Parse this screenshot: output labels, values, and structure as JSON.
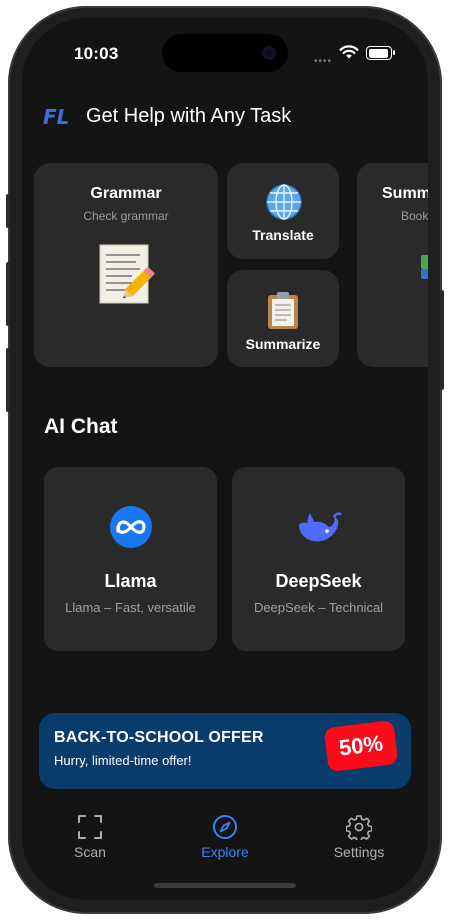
{
  "status": {
    "time": "10:03"
  },
  "header": {
    "title": "Get Help with Any Task",
    "logo_text": "FL"
  },
  "tools": {
    "grammar": {
      "title": "Grammar",
      "subtitle": "Check grammar",
      "icon": "memo-pencil-icon"
    },
    "translate": {
      "title": "Translate",
      "icon": "globe-icon"
    },
    "summarize": {
      "title": "Summarize",
      "icon": "clipboard-icon"
    },
    "partial": {
      "title": "Summ",
      "subtitle": "Book"
    }
  },
  "ai_chat": {
    "title": "AI Chat",
    "items": [
      {
        "name": "Llama",
        "description": "Llama – Fast, versatile",
        "icon": "meta-icon",
        "color": "#1877f2"
      },
      {
        "name": "DeepSeek",
        "description": "DeepSeek – Technical",
        "icon": "whale-icon",
        "color": "#4d6bfe"
      }
    ]
  },
  "promo": {
    "title": "BACK-TO-SCHOOL OFFER",
    "subtitle": "Hurry, limited-time offer!",
    "badge": "50%",
    "bg_color": "#093b6b",
    "badge_color": "#ff0a1a"
  },
  "tabbar": {
    "items": [
      {
        "label": "Scan",
        "icon": "scan-icon",
        "active": false
      },
      {
        "label": "Explore",
        "icon": "compass-icon",
        "active": true
      },
      {
        "label": "Settings",
        "icon": "gear-icon",
        "active": false
      }
    ],
    "active_color": "#3b82f6",
    "inactive_color": "#b0b0b0"
  }
}
